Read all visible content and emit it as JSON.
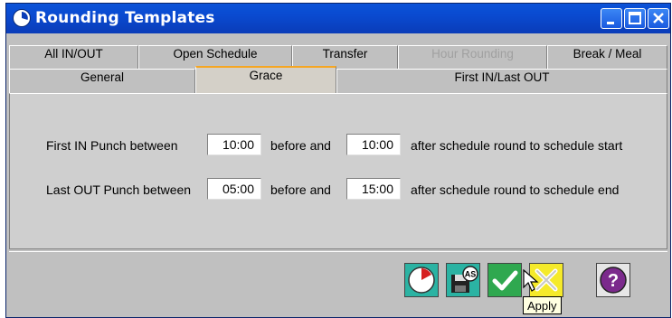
{
  "window": {
    "title": "Rounding Templates"
  },
  "tabs": {
    "row1": [
      {
        "label": "All IN/OUT",
        "disabled": false
      },
      {
        "label": "Open Schedule",
        "disabled": false
      },
      {
        "label": "Transfer",
        "disabled": false
      },
      {
        "label": "Hour Rounding",
        "disabled": true
      },
      {
        "label": "Break / Meal",
        "disabled": false
      }
    ],
    "row2": [
      {
        "label": "General",
        "active": false
      },
      {
        "label": "Grace",
        "active": true
      },
      {
        "label": "First IN/Last OUT",
        "active": false
      }
    ]
  },
  "grace": {
    "first_in": {
      "label": "First IN Punch between",
      "before_value": "10:00",
      "before_text": "before and",
      "after_value": "10:00",
      "after_text": "after schedule round to schedule start"
    },
    "last_out": {
      "label": "Last OUT Punch between",
      "before_value": "05:00",
      "before_text": "before and",
      "after_value": "15:00",
      "after_text": "after schedule round to schedule end"
    }
  },
  "buttons": {
    "save_as_badge": "AS",
    "help_symbol": "?",
    "apply_tooltip": "Apply"
  },
  "icons": [
    "clock-icon",
    "save-as-icon",
    "checkmark-icon",
    "cancel-x-icon",
    "help-icon"
  ],
  "colors": {
    "title_bar": "#0a4ad0",
    "apply_button": "#2fa84f",
    "cancel_button": "#f5ea2a",
    "help_button": "#7b2a8c",
    "active_tab_accent": "#f5a623"
  }
}
